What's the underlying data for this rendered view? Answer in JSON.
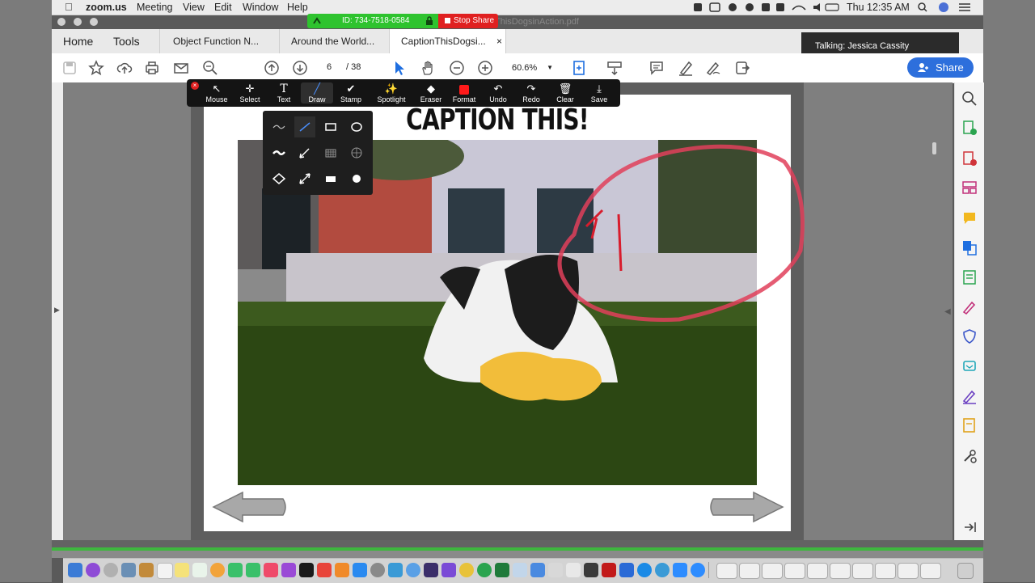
{
  "menubar": {
    "app": "zoom.us",
    "items": [
      "Meeting",
      "View",
      "Edit",
      "Window",
      "Help"
    ],
    "clock": "Thu 12:35 AM"
  },
  "share_bar": {
    "meeting_id": "ID: 734-7518-0584",
    "stop_label": "Stop Share"
  },
  "window_title": "ThisDogsinAction.pdf",
  "tabs": {
    "home": "Home",
    "tools": "Tools",
    "docs": [
      "Object Function N...",
      "Around the World...",
      "CaptionThisDogsi..."
    ]
  },
  "toolbar": {
    "page_current": "6",
    "page_total": "/ 38",
    "zoom": "60.6%"
  },
  "talking": "Talking: Jessica Cassity",
  "share_button": "Share",
  "annotation_tools": [
    {
      "label": "Mouse",
      "icon": "cursor-icon"
    },
    {
      "label": "Select",
      "icon": "move-icon"
    },
    {
      "label": "Text",
      "icon": "text-icon"
    },
    {
      "label": "Draw",
      "icon": "pen-icon"
    },
    {
      "label": "Stamp",
      "icon": "check-icon"
    },
    {
      "label": "Spotlight",
      "icon": "spotlight-icon"
    },
    {
      "label": "Eraser",
      "icon": "eraser-icon"
    },
    {
      "label": "Format",
      "icon": "color-swatch-icon"
    },
    {
      "label": "Undo",
      "icon": "undo-icon"
    },
    {
      "label": "Redo",
      "icon": "redo-icon"
    },
    {
      "label": "Clear",
      "icon": "trash-icon"
    },
    {
      "label": "Save",
      "icon": "save-icon"
    }
  ],
  "format_color": "#ff1a1a",
  "slide": {
    "title": "CAPTION THIS!"
  },
  "colors": {
    "accent": "#2d6fdc",
    "annotation": "#e0405a",
    "stop_share": "#e02020",
    "share_green": "#2ec32e"
  }
}
